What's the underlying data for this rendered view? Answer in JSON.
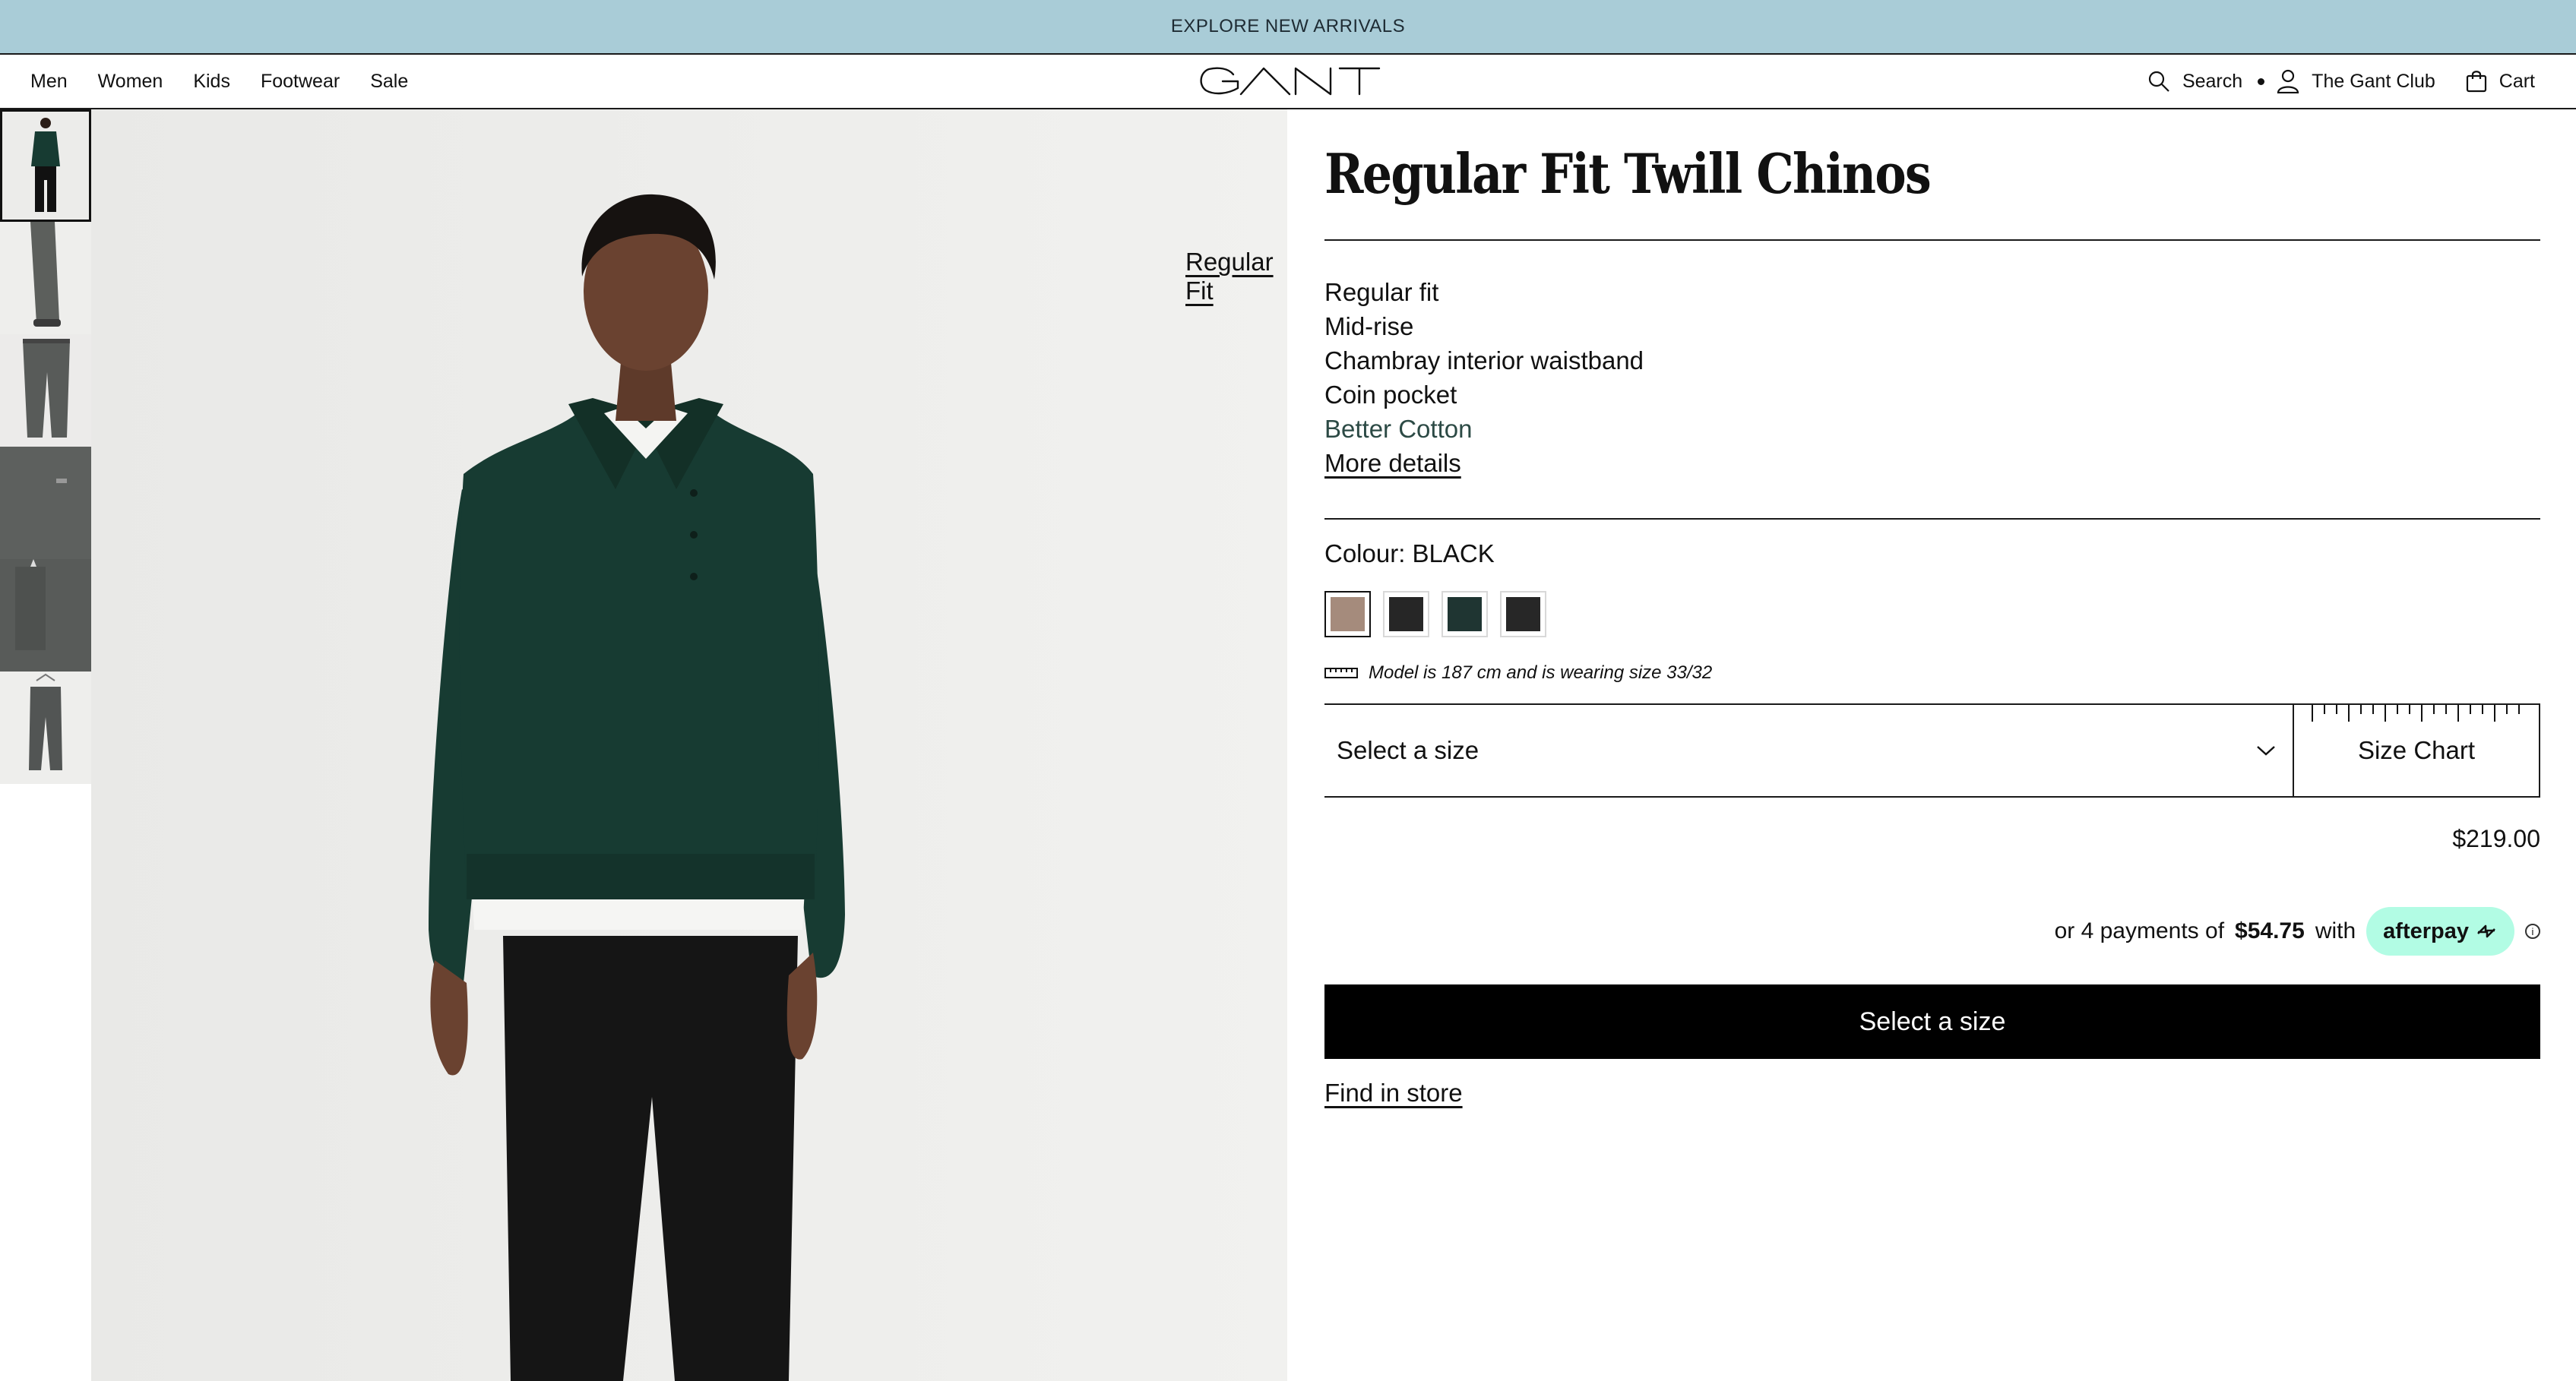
{
  "announcement": {
    "text": "EXPLORE NEW ARRIVALS"
  },
  "nav": {
    "left": [
      "Men",
      "Women",
      "Kids",
      "Footwear",
      "Sale"
    ],
    "brand": "GANT",
    "search_label": "Search",
    "club_label": "The Gant Club",
    "cart_label": "Cart"
  },
  "gallery": {
    "fit_label": "Regular Fit",
    "fit_help": "?",
    "thumbnail_count": 6,
    "active_thumbnail": 1
  },
  "product": {
    "title": "Regular Fit Twill Chinos",
    "features": [
      "Regular fit",
      "Mid-rise",
      "Chambray interior waistband",
      "Coin pocket"
    ],
    "sustainability": "Better Cotton",
    "more_details": "More details",
    "colour_label": "Colour: BLACK",
    "swatches": [
      {
        "name": "khaki",
        "color": "#a58b7c",
        "selected": true
      },
      {
        "name": "black",
        "color": "#262626",
        "selected": false
      },
      {
        "name": "dark-green",
        "color": "#1f3532",
        "selected": false
      },
      {
        "name": "charcoal",
        "color": "#272727",
        "selected": false
      }
    ],
    "model_note": "Model is 187 cm and is wearing size 33/32",
    "size_placeholder": "Select a size",
    "size_chart_label": "Size Chart",
    "price": "$219.00",
    "afterpay": {
      "prefix": "or 4 payments of",
      "amount": "$54.75",
      "suffix": "with",
      "badge": "afterpay"
    },
    "cta_label": "Select a size",
    "find_in_store": "Find in store"
  },
  "colors": {
    "announcement_bg": "#a9ccd7",
    "afterpay_badge": "#b2fce4",
    "sweater_green": "#173b32",
    "cta_bg": "#000000"
  }
}
